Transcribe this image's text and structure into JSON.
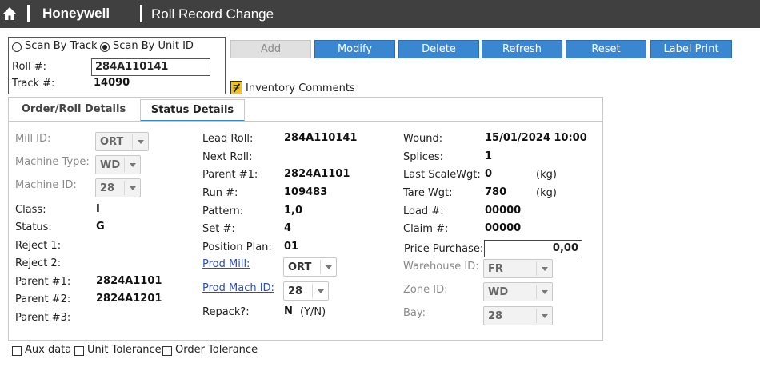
{
  "header": {
    "brand": "Honeywell",
    "title": "Roll Record Change",
    "home_icon": "home-icon"
  },
  "scan": {
    "option_track": "Scan By Track",
    "option_unit": "Scan By Unit ID",
    "selected": "Scan By Unit ID",
    "roll_label": "Roll #:",
    "roll_value": "284A110141",
    "track_label": "Track #:",
    "track_value": "14090"
  },
  "toolbar": {
    "add": "Add",
    "modify": "Modify",
    "delete": "Delete",
    "refresh": "Refresh",
    "reset": "Reset",
    "label_print": "Label Print",
    "inventory_comments": "Inventory Comments"
  },
  "tabs": {
    "order_roll": "Order/Roll Details",
    "status": "Status Details",
    "active": "Status Details"
  },
  "col1": {
    "mill_id_label": "Mill ID:",
    "mill_id_value": "ORT",
    "machine_type_label": "Machine Type:",
    "machine_type_value": "WD",
    "machine_id_label": "Machine ID:",
    "machine_id_value": "28",
    "class_label": "Class:",
    "class_value": "I",
    "status_label": "Status:",
    "status_value": "G",
    "reject1_label": "Reject 1:",
    "reject2_label": "Reject 2:",
    "parent1_label": "Parent #1:",
    "parent1_value": "2824A1101",
    "parent2_label": "Parent #2:",
    "parent2_value": "2824A1201",
    "parent3_label": "Parent #3:"
  },
  "col2": {
    "lead_roll_label": "Lead Roll:",
    "lead_roll_value": "284A110141",
    "next_roll_label": "Next Roll:",
    "parent1_label": "Parent #1:",
    "parent1_value": "2824A1101",
    "run_label": "Run #:",
    "run_value": "109483",
    "pattern_label": "Pattern:",
    "pattern_value": "1,0",
    "set_label": "Set #:",
    "set_value": "4",
    "position_plan_label": "Position Plan:",
    "position_plan_value": "01",
    "prod_mill_label": "Prod Mill:",
    "prod_mill_value": "ORT",
    "prod_mach_label": "Prod Mach ID:",
    "prod_mach_value": "28",
    "repack_label": "Repack?:",
    "repack_value": "N",
    "repack_hint": "(Y/N)"
  },
  "col3": {
    "wound_label": "Wound:",
    "wound_value": "15/01/2024 10:00",
    "splices_label": "Splices:",
    "splices_value": "1",
    "last_scale_label": "Last ScaleWgt:",
    "last_scale_value": "0",
    "last_scale_unit": "(kg)",
    "tare_label": "Tare Wgt:",
    "tare_value": "780",
    "tare_unit": "(kg)",
    "load_label": "Load #:",
    "load_value": "00000",
    "claim_label": "Claim #:",
    "claim_value": "00000",
    "price_label": "Price Purchase:",
    "price_value": "0,00",
    "warehouse_label": "Warehouse ID:",
    "warehouse_value": "FR",
    "zone_label": "Zone ID:",
    "zone_value": "WD",
    "bay_label": "Bay:",
    "bay_value": "28"
  },
  "footer": {
    "aux_data": "Aux data",
    "unit_tolerance": "Unit Tolerance",
    "order_tolerance": "Order Tolerance"
  }
}
